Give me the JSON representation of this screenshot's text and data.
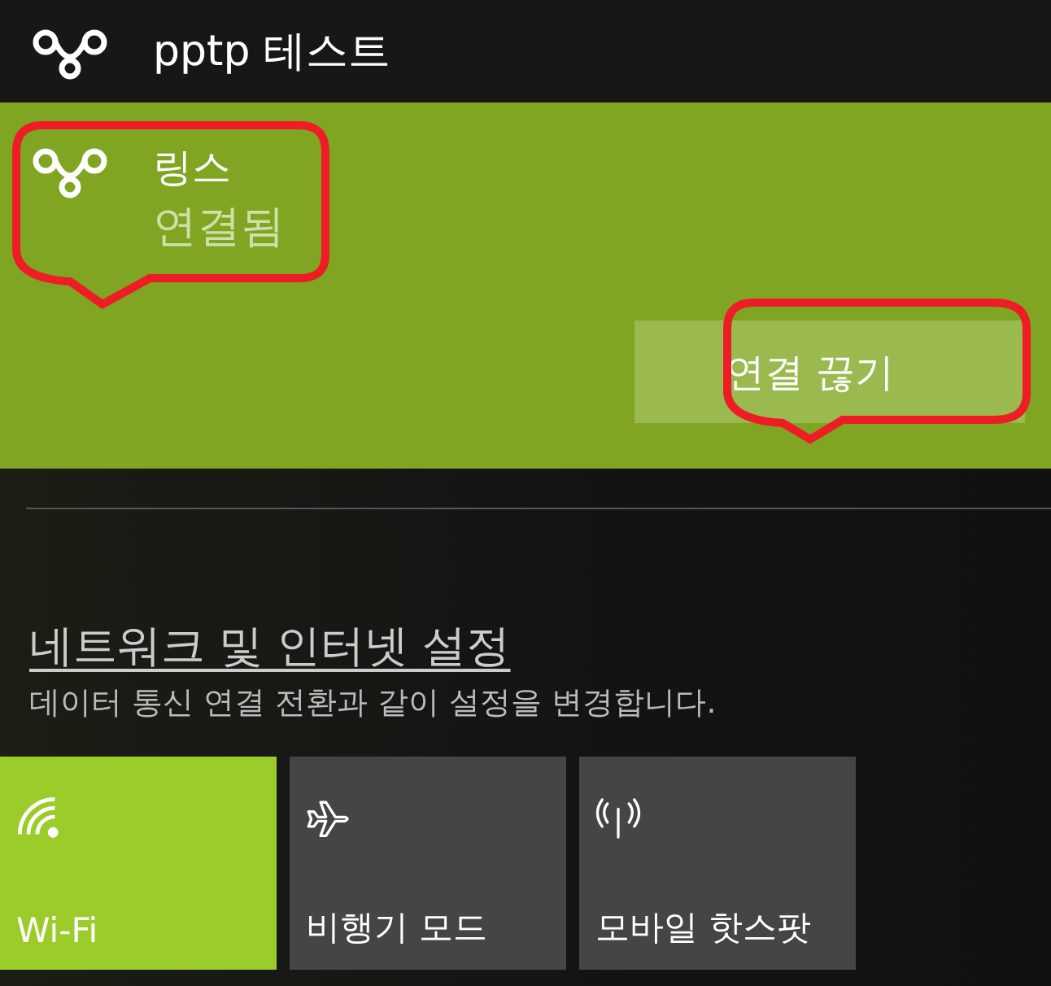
{
  "top_connection": {
    "name": "pptp 테스트"
  },
  "active_connection": {
    "name": "링스",
    "status": "연결됨",
    "button": "연결 끊기"
  },
  "settings_link": {
    "title": "네트워크 및 인터넷 설정",
    "description": "데이터 통신 연결 전환과 같이 설정을 변경합니다."
  },
  "tiles": [
    {
      "kind": "wifi",
      "label": "Wi-Fi",
      "on": true
    },
    {
      "kind": "airplane",
      "label": "비행기 모드",
      "on": false
    },
    {
      "kind": "hotspot",
      "label": "모바일 핫스팟",
      "on": false
    }
  ]
}
